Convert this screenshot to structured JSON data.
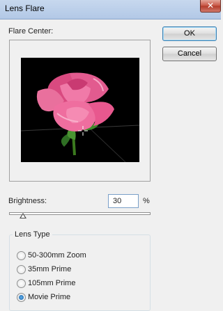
{
  "window": {
    "title": "Lens Flare",
    "close_glyph": "✕"
  },
  "flare_center": {
    "label": "Flare Center:"
  },
  "buttons": {
    "ok": "OK",
    "cancel": "Cancel"
  },
  "brightness": {
    "label": "Brightness:",
    "value": "30",
    "unit": "%",
    "slider_fraction": 0.1
  },
  "lens_type": {
    "legend": "Lens Type",
    "options": [
      {
        "label": "50-300mm Zoom",
        "checked": false
      },
      {
        "label": "35mm Prime",
        "checked": false
      },
      {
        "label": "105mm Prime",
        "checked": false
      },
      {
        "label": "Movie Prime",
        "checked": true
      }
    ]
  },
  "colors": {
    "titlebar": "#b9cee9",
    "preview_background": "#000000",
    "rose": "#e9578f",
    "leaf": "#2e7d32"
  },
  "icons": {
    "crosshair": "crosshair-icon",
    "rose": "rose-image"
  }
}
